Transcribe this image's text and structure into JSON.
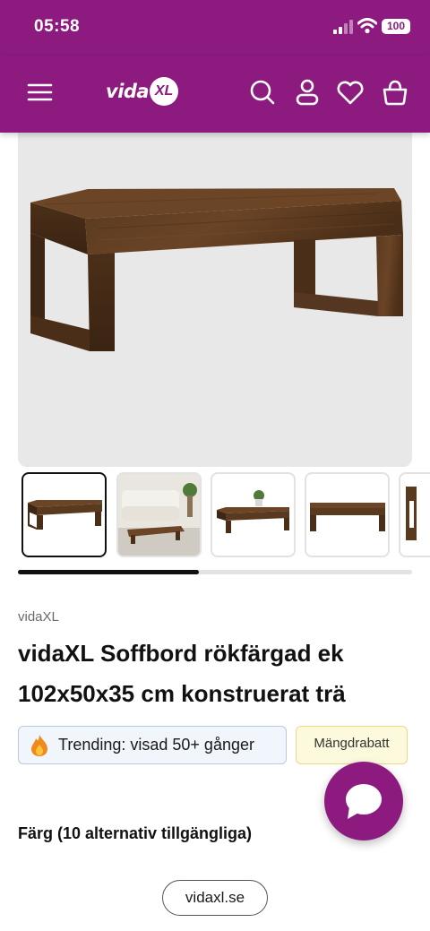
{
  "status_bar": {
    "time": "05:58",
    "battery": "100",
    "icons": [
      "signal-icon",
      "wifi-icon",
      "battery-icon"
    ]
  },
  "header": {
    "brand_color": "#8c1a7f",
    "logo_text": "vida",
    "logo_mark": "XL",
    "icons": [
      "menu-icon",
      "search-icon",
      "account-icon",
      "heart-icon",
      "cart-icon"
    ]
  },
  "gallery": {
    "hero_background": "#e8e8e8",
    "thumbnails": [
      {
        "name": "thumbnail-product",
        "selected": true
      },
      {
        "name": "thumbnail-livingroom",
        "selected": false
      },
      {
        "name": "thumbnail-styled-table",
        "selected": false
      },
      {
        "name": "thumbnail-side-view",
        "selected": false
      },
      {
        "name": "thumbnail-partial",
        "selected": false
      }
    ],
    "scroll_progress_fraction": 0.46
  },
  "product": {
    "brand": "vidaXL",
    "title": "vidaXL Soffbord rökfärgad ek 102x50x35 cm konstruerat trä",
    "trending_label": "Trending: visad 50+ gånger",
    "discount_badge": "Mängdrabatt",
    "color_section_title": "Färg (10 alternativ tillgängliga)"
  },
  "browser": {
    "url": "vidaxl.se"
  }
}
